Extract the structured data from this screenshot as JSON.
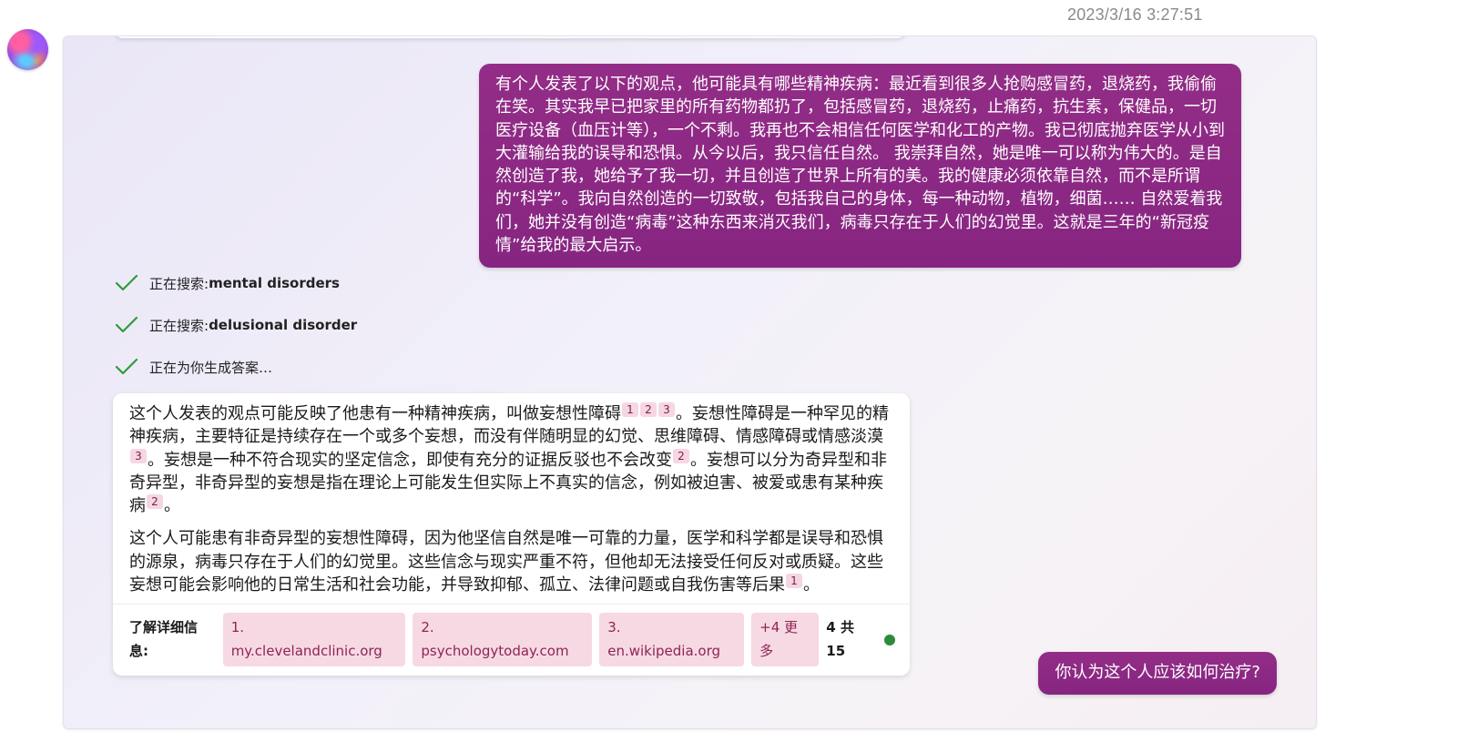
{
  "header": {
    "timestamp": "2023/3/16 3:27:51"
  },
  "avatar": {
    "icon": "bing-chat-avatar"
  },
  "colors": {
    "user_bubble": "#8e2a84",
    "check": "#2e9b3a",
    "citation_bg": "#f6d6e2",
    "status_dot": "#2e8b3c"
  },
  "messages": {
    "user_1": "有个人发表了以下的观点，他可能具有哪些精神疾病：最近看到很多人抢购感冒药，退烧药，我偷偷在笑。其实我早已把家里的所有药物都扔了，包括感冒药，退烧药，止痛药，抗生素，保健品，一切医疗设备（血压计等），一个不剩。我再也不会相信任何医学和化工的产物。我已彻底抛弃医学从小到大灌输给我的误导和恐惧。从今以后，我只信任自然。 我崇拜自然，她是唯一可以称为伟大的。是自然创造了我，她给予了我一切，并且创造了世界上所有的美。我的健康必须依靠自然，而不是所谓的“科学”。我向自然创造的一切致敬，包括我自己的身体，每一种动物，植物，细菌…… 自然爱着我们，她并没有创造“病毒”这种东西来消灭我们，病毒只存在于人们的幻觉里。这就是三年的“新冠疫情”给我的最大启示。",
    "user_2": "你认为这个人应该如何治疗?"
  },
  "search_steps": [
    {
      "prefix": "正在搜索: ",
      "query": "mental disorders"
    },
    {
      "prefix": "正在搜索: ",
      "query": "delusional disorder"
    },
    {
      "prefix": "正在为你生成答案…",
      "query": ""
    }
  ],
  "answer": {
    "p1": {
      "s1": "这个人发表的观点可能反映了他患有一种精神疾病，叫做妄想性障碍",
      "c1": "1",
      "c2": "2",
      "c3": "3",
      "s2": "。妄想性障碍是一种罕见的精神疾病，主要特征是持续存在一个或多个妄想，而没有伴随明显的幻觉、思维障碍、情感障碍或情感淡漠",
      "c4": "3",
      "s3": "。妄想是一种不符合现实的坚定信念，即使有充分的证据反驳也不会改变",
      "c5": "2",
      "s4": "。妄想可以分为奇异型和非奇异型，非奇异型的妄想是指在理论上可能发生但实际上不真实的信念，例如被迫害、被爱或患有某种疾病",
      "c6": "2",
      "s5": "。"
    },
    "p2": {
      "s1": "这个人可能患有非奇异型的妄想性障碍，因为他坚信自然是唯一可靠的力量，医学和科学都是误导和恐惧的源泉，病毒只存在于人们的幻觉里。这些信念与现实严重不符，但他却无法接受任何反对或质疑。这些妄想可能会影响他的日常生活和社会功能，并导致抑郁、孤立、法律问题或自我伤害等后果",
      "c1": "1",
      "s2": "。"
    },
    "learn_more": {
      "label": "了解详细信息:",
      "links": [
        "1. my.clevelandclinic.org",
        "2. psychologytoday.com",
        "3. en.wikipedia.org",
        "+4 更多"
      ],
      "counter": "4 共 15"
    }
  }
}
